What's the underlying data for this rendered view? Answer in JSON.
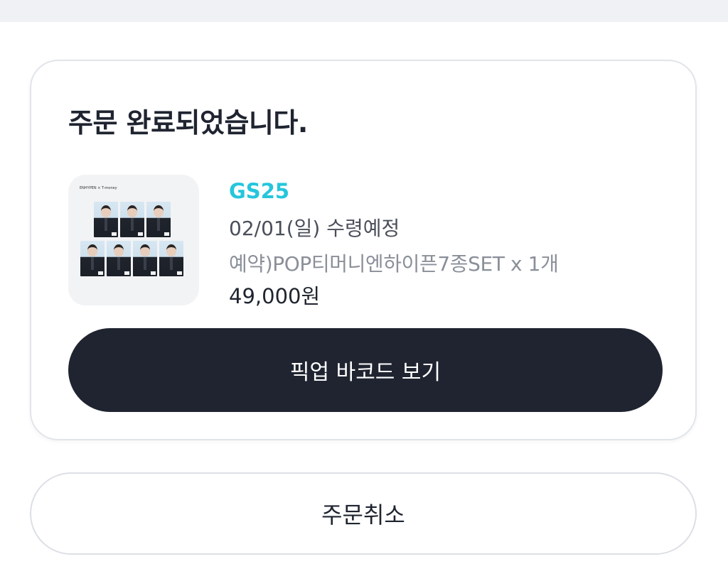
{
  "order": {
    "title": "주문 완료되었습니다.",
    "store": "GS25",
    "pickup_date": "02/01(일) 수령예정",
    "product": "예약)POP티머니엔하이픈7종SET x 1개",
    "price": "49,000원",
    "thumbnail_caption": "ENHYPEN × T-money",
    "barcode_button_label": "픽업 바코드 보기"
  },
  "cancel_button_label": "주문취소",
  "colors": {
    "store_accent": "#25c6dc",
    "primary_button": "#1f2430",
    "top_bar": "#eff1f5"
  }
}
